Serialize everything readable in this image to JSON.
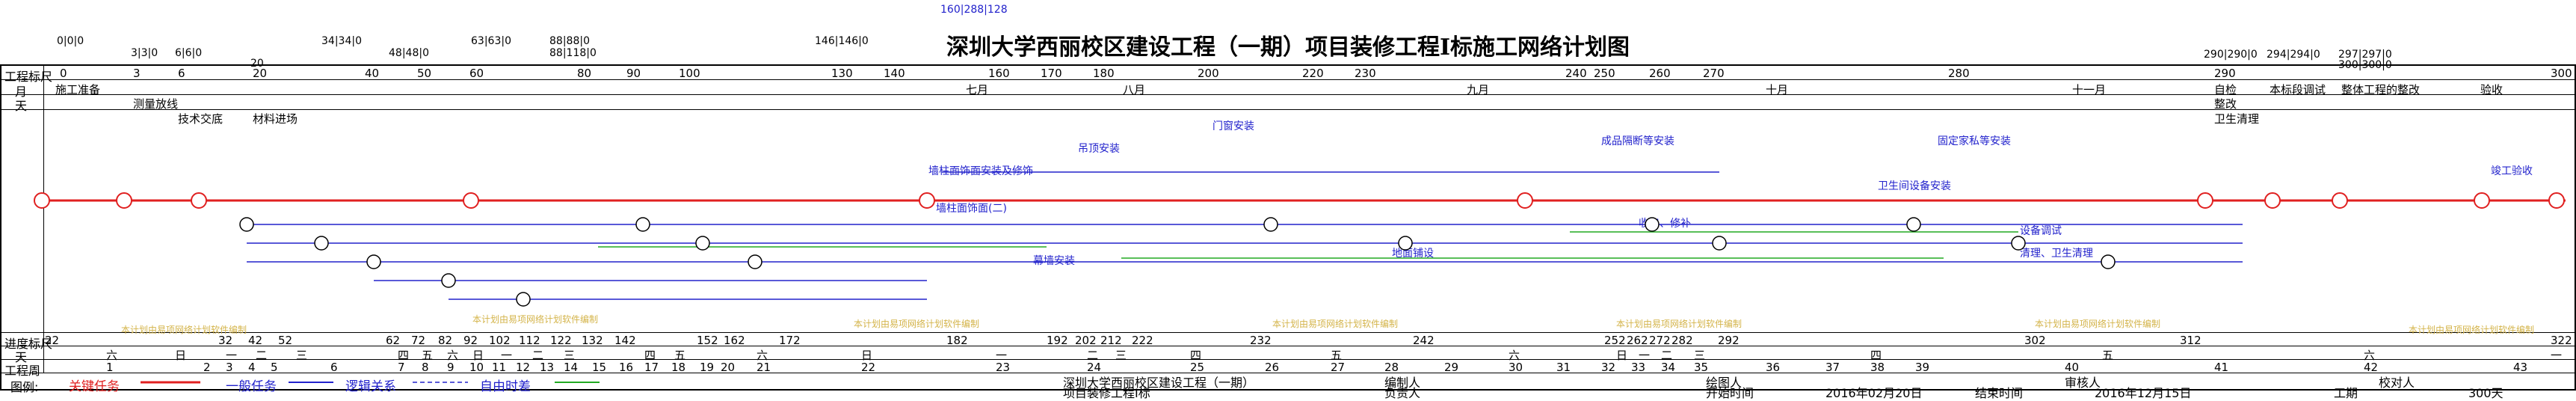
{
  "title": "深圳大学西丽校区建设工程（一期）项目装修工程Ⅰ标施工网络计划图",
  "top_labels": {
    "duration": "工程标尺",
    "month": "月",
    "day": "天",
    "schedule": "进度标尺",
    "day_bottom": "天",
    "week": "工程周"
  },
  "top_numbers": [
    "0|0|0",
    "3|3|0",
    "6|6|0",
    "20",
    "34|34|0",
    "48|48|0",
    "63|63|0",
    "88|88|0",
    "88|118|0",
    "146|146|0",
    "160|288|128",
    "290|290|0",
    "294|294|0",
    "297|297|0",
    "300|300|0"
  ],
  "ruler_top": [
    "0",
    "3",
    "6",
    "20",
    "40",
    "50",
    "60",
    "80",
    "90",
    "100",
    "130",
    "140",
    "160",
    "170",
    "180",
    "200",
    "220",
    "230",
    "240",
    "250",
    "260",
    "270",
    "280",
    "290",
    "300"
  ],
  "months": [
    "七月",
    "八月",
    "九月",
    "十月",
    "十一月"
  ],
  "early_tasks": [
    "施工准备",
    "测量放线",
    "技术交底",
    "材料进场"
  ],
  "late_tasks": [
    "自检",
    "整改",
    "卫生清理",
    "本标段调试",
    "整体工程的整改",
    "验收"
  ],
  "task_labels": [
    "墙柱面饰面安装及修饰",
    "墙柱面饰面(二)",
    "幕墙安装",
    "地面铺设",
    "门窗安装",
    "吊顶安装",
    "成品隔断等安装",
    "固定家私等安装",
    "卫生间设备安装",
    "设备调试",
    "清理、卫生清理",
    "收口、修补",
    "竣工验收"
  ],
  "ruler_bottom": [
    "22",
    "32",
    "42",
    "52",
    "62",
    "72",
    "82",
    "92",
    "102",
    "112",
    "122",
    "132",
    "142",
    "152",
    "162",
    "172",
    "182",
    "192",
    "202",
    "212",
    "222",
    "232",
    "242",
    "252",
    "262",
    "272",
    "282",
    "292",
    "302",
    "312",
    "322"
  ],
  "weekdays": [
    "六",
    "日",
    "一",
    "二",
    "三",
    "四",
    "五",
    "六",
    "日",
    "一",
    "二",
    "三",
    "四",
    "五",
    "六",
    "日",
    "一",
    "二",
    "三",
    "四",
    "五",
    "六",
    "日",
    "一",
    "二",
    "三",
    "四",
    "五",
    "六",
    "日",
    "一"
  ],
  "weeks": [
    "1",
    "2",
    "3",
    "4",
    "5",
    "6",
    "7",
    "8",
    "9",
    "10",
    "11",
    "12",
    "13",
    "14",
    "15",
    "16",
    "17",
    "18",
    "19",
    "20",
    "21",
    "22",
    "23",
    "24",
    "25",
    "26",
    "27",
    "28",
    "29",
    "30",
    "31",
    "32",
    "33",
    "34",
    "35",
    "36",
    "37",
    "38",
    "39",
    "40",
    "41",
    "42",
    "43"
  ],
  "watermark": "本计划由易项网络计划软件编制",
  "footer": {
    "legend_label": "图例:",
    "critical": "关键任务",
    "normal": "一般任务",
    "logic": "逻辑关系",
    "float": "自由时差",
    "project_line1": "深圳大学西丽校区建设工程（一期）",
    "project_line2": "项目装修工程Ⅰ标",
    "editor_label": "编制人",
    "owner_label": "负责人",
    "drawer_label": "绘图人",
    "reviewer_label": "审核人",
    "checker_label": "校对人",
    "start_label": "开始时间",
    "start_value": "2016年02月20日",
    "end_label": "结束时间",
    "end_value": "2016年12月15日",
    "duration_label": "工期",
    "duration_value": "300天"
  },
  "colors": {
    "critical": "#e02020",
    "normal": "#2222cc",
    "logic": "#2222cc",
    "float": "#22aa22",
    "watermark": "#d4b44a"
  }
}
